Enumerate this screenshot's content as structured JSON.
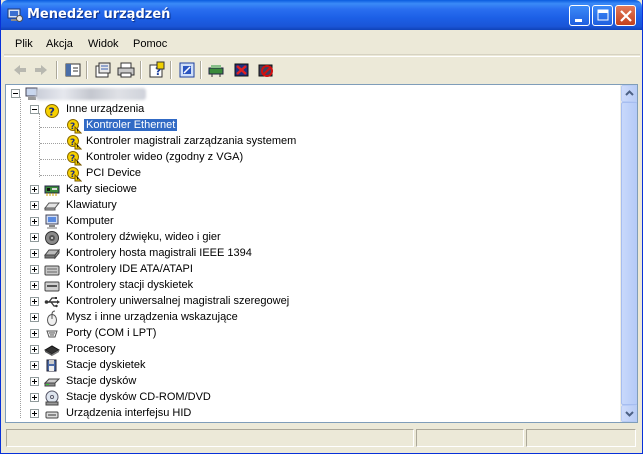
{
  "window": {
    "title": "Menedżer urządzeń"
  },
  "colors": {
    "titlebar": "#0a5bdf",
    "selection": "#316ac5",
    "warning": "#f7d100"
  },
  "menu": {
    "items": [
      "Plik",
      "Akcja",
      "Widok",
      "Pomoc"
    ]
  },
  "toolbar": {
    "icons": [
      "back-arrow-icon",
      "forward-arrow-icon",
      "console-tree-icon",
      "properties-icon",
      "print-icon",
      "help-icon",
      "scan-hardware-icon",
      "update-driver-icon",
      "uninstall-icon",
      "disable-icon"
    ]
  },
  "tree": {
    "root": {
      "label": "",
      "blurred": true
    },
    "other_devices": {
      "label": "Inne urządzenia",
      "children": [
        {
          "label": "Kontroler Ethernet",
          "selected": true
        },
        {
          "label": "Kontroler magistrali zarządzania systemem"
        },
        {
          "label": "Kontroler wideo (zgodny z VGA)"
        },
        {
          "label": "PCI Device"
        }
      ]
    },
    "categories": [
      {
        "label": "Karty sieciowe",
        "icon": "network-card-icon"
      },
      {
        "label": "Klawiatury",
        "icon": "keyboard-icon"
      },
      {
        "label": "Komputer",
        "icon": "computer-icon"
      },
      {
        "label": "Kontrolery dźwięku, wideo i gier",
        "icon": "sound-icon"
      },
      {
        "label": "Kontrolery hosta magistrali IEEE 1394",
        "icon": "firewire-icon"
      },
      {
        "label": "Kontrolery IDE ATA/ATAPI",
        "icon": "ide-icon"
      },
      {
        "label": "Kontrolery stacji dyskietek",
        "icon": "floppy-controller-icon"
      },
      {
        "label": "Kontrolery uniwersalnej magistrali szeregowej",
        "icon": "usb-icon"
      },
      {
        "label": "Mysz i inne urządzenia wskazujące",
        "icon": "mouse-icon"
      },
      {
        "label": "Porty (COM i LPT)",
        "icon": "port-icon"
      },
      {
        "label": "Procesory",
        "icon": "processor-icon"
      },
      {
        "label": "Stacje dyskietek",
        "icon": "floppy-icon"
      },
      {
        "label": "Stacje dysków",
        "icon": "disk-drive-icon"
      },
      {
        "label": "Stacje dysków CD-ROM/DVD",
        "icon": "cdrom-icon"
      },
      {
        "label": "Urządzenia interfejsu HID",
        "icon": "hid-icon"
      }
    ]
  },
  "status": {
    "text": ""
  }
}
